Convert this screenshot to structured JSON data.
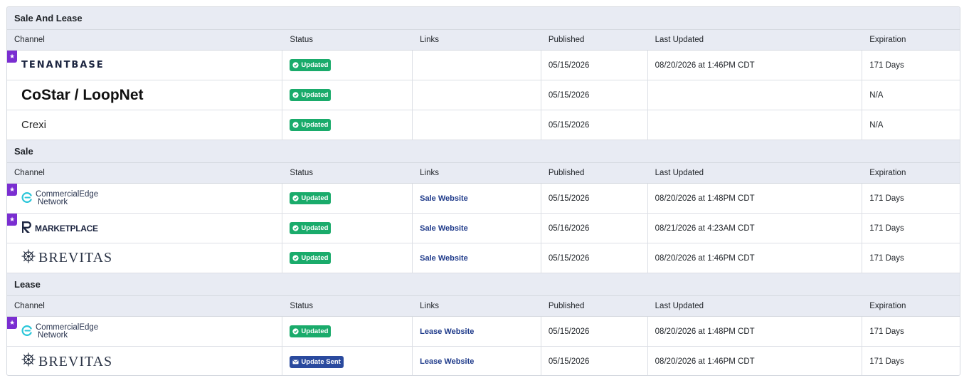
{
  "columns": {
    "channel": "Channel",
    "status": "Status",
    "links": "Links",
    "published": "Published",
    "last_updated": "Last Updated",
    "expiration": "Expiration"
  },
  "sections": [
    {
      "title": "Sale And Lease",
      "rows": [
        {
          "logo": "tenantbase",
          "logo_text": "TENANTBASE",
          "featured": true,
          "status": "Updated",
          "status_type": "updated",
          "link": "",
          "published": "05/15/2026",
          "last_updated": "08/20/2026 at 1:46PM CDT",
          "expiration": "171 Days"
        },
        {
          "logo": "costar",
          "logo_text": "CoStar / LoopNet",
          "featured": false,
          "status": "Updated",
          "status_type": "updated",
          "link": "",
          "published": "05/15/2026",
          "last_updated": "",
          "expiration": "N/A"
        },
        {
          "logo": "crexi",
          "logo_text": "Crexi",
          "featured": false,
          "status": "Updated",
          "status_type": "updated",
          "link": "",
          "published": "05/15/2026",
          "last_updated": "",
          "expiration": "N/A"
        }
      ]
    },
    {
      "title": "Sale",
      "rows": [
        {
          "logo": "commercialedge",
          "logo_text": "CommercialEdge",
          "logo_sub": "Network",
          "featured": true,
          "status": "Updated",
          "status_type": "updated",
          "link": "Sale Website",
          "published": "05/15/2026",
          "last_updated": "08/20/2026 at 1:48PM CDT",
          "expiration": "171 Days"
        },
        {
          "logo": "rmarketplace",
          "logo_text": "MARKETPLACE",
          "featured": true,
          "status": "Updated",
          "status_type": "updated",
          "link": "Sale Website",
          "published": "05/16/2026",
          "last_updated": "08/21/2026 at 4:23AM CDT",
          "expiration": "171 Days"
        },
        {
          "logo": "brevitas",
          "logo_text": "BREVITAS",
          "featured": false,
          "status": "Updated",
          "status_type": "updated",
          "link": "Sale Website",
          "published": "05/15/2026",
          "last_updated": "08/20/2026 at 1:46PM CDT",
          "expiration": "171 Days"
        }
      ]
    },
    {
      "title": "Lease",
      "rows": [
        {
          "logo": "commercialedge",
          "logo_text": "CommercialEdge",
          "logo_sub": "Network",
          "featured": true,
          "status": "Updated",
          "status_type": "updated",
          "link": "Lease Website",
          "published": "05/15/2026",
          "last_updated": "08/20/2026 at 1:48PM CDT",
          "expiration": "171 Days"
        },
        {
          "logo": "brevitas",
          "logo_text": "BREVITAS",
          "featured": false,
          "status": "Update Sent",
          "status_type": "sent",
          "link": "Lease Website",
          "published": "05/15/2026",
          "last_updated": "08/20/2026 at 1:46PM CDT",
          "expiration": "171 Days"
        }
      ]
    }
  ],
  "icons": {
    "featured": "star-icon",
    "updated": "check-circle-icon",
    "sent": "envelope-icon"
  },
  "colors": {
    "updated": "#1aab6b",
    "sent": "#2a4a9e",
    "featured": "#7a2ed1",
    "link": "#1e3a8a",
    "header_bg": "#e8ebf3"
  }
}
